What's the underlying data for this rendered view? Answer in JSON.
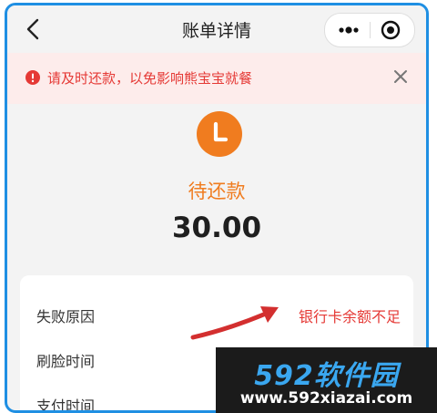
{
  "header": {
    "title": "账单详情"
  },
  "alert": {
    "message": "请及时还款，以免影响熊宝宝就餐"
  },
  "status": {
    "label": "待还款",
    "amount": "30.00"
  },
  "details": {
    "rows": [
      {
        "label": "失败原因",
        "value": "银行卡余额不足"
      },
      {
        "label": "刷脸时间",
        "value": ""
      },
      {
        "label": "支付时间",
        "value": ""
      }
    ]
  },
  "watermark": {
    "brand": "592软件园",
    "url": "www.592xiazai.com"
  },
  "colors": {
    "accent_orange": "#f07c1f",
    "error_red": "#e53935",
    "frame_blue": "#1f8fe3",
    "alert_bg": "#fdeceb"
  },
  "icons": {
    "back": "chevron-left-icon",
    "more": "more-dots-icon",
    "close_app": "target-icon",
    "alert": "exclamation-circle-icon",
    "dismiss": "close-icon",
    "status": "clock-icon"
  }
}
